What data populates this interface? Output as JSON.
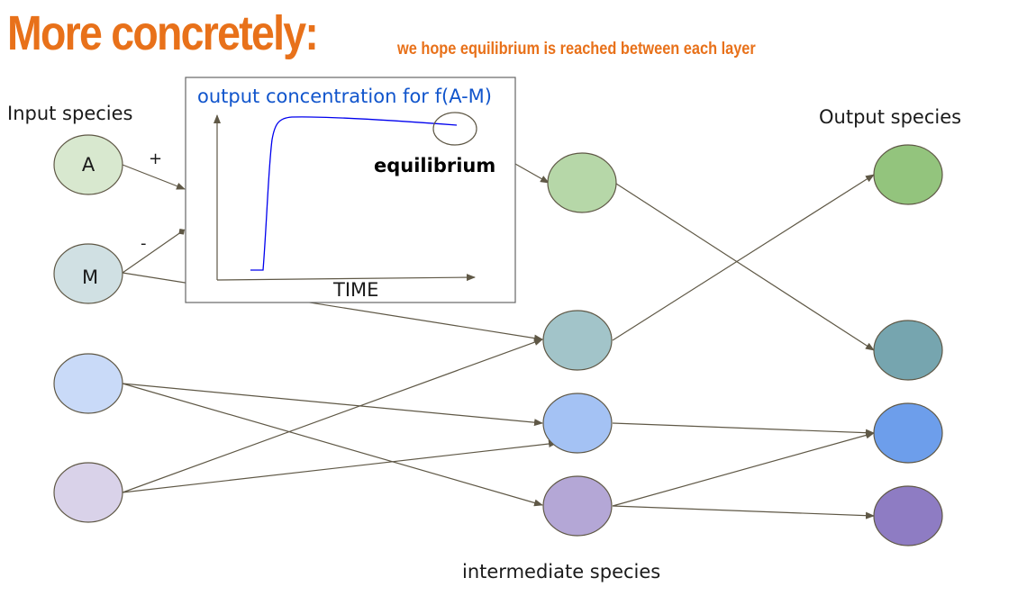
{
  "title": "More concretely:",
  "subtitle": "we hope equilibrium is reached between each layer",
  "input_label": "Input species",
  "output_label": "Output species",
  "intermediate_label": "intermediate species",
  "inset": {
    "title": "output concentration for f(A-M)",
    "x_axis_label": "TIME",
    "equilibrium_label": "equilibrium"
  },
  "edge_signs": {
    "plus": "+",
    "minus": "-"
  },
  "nodes": {
    "input": [
      {
        "text": "A",
        "color": "#d8e8cf"
      },
      {
        "text": "M",
        "color": "#d0e0e3"
      },
      {
        "text": "",
        "color": "#c9daf8"
      },
      {
        "text": "",
        "color": "#d9d2e9"
      }
    ],
    "intermediate": [
      {
        "color": "#b6d7a8"
      },
      {
        "color": "#a2c4c9"
      },
      {
        "color": "#a4c2f4"
      },
      {
        "color": "#b4a7d6"
      }
    ],
    "output": [
      {
        "color": "#93c47d"
      },
      {
        "color": "#76a5af"
      },
      {
        "color": "#6d9eeb"
      },
      {
        "color": "#8e7cc3"
      }
    ]
  },
  "colors": {
    "title": "#e8711a",
    "inset_title": "#1155cc",
    "curve": "#0000ee",
    "arrow": "#5f5846"
  }
}
